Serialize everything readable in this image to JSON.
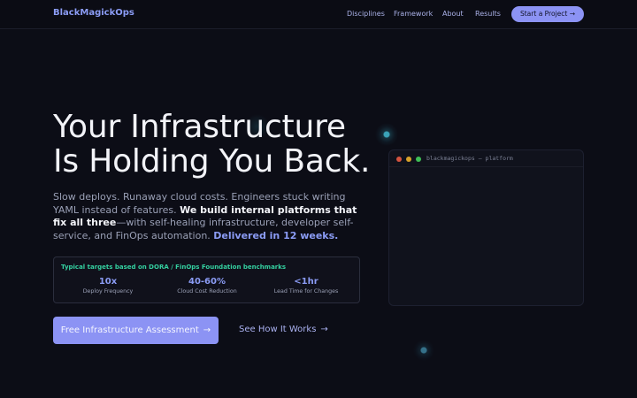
{
  "nav": {
    "brand": "BlackMagickOps",
    "links": [
      "Disciplines",
      "Framework",
      "About",
      "Results"
    ],
    "cta": "Start a Project →"
  },
  "hero": {
    "title_line1": "Your Infrastructure",
    "title_line2": "Is Holding You Back.",
    "sub_part1": "Slow deploys. Runaway cloud costs. Engineers stuck writing YAML instead of features. ",
    "sub_bold": "We build internal platforms that fix all three",
    "sub_part2": "—with self-healing infrastructure, developer self-service, and FinOps automation. ",
    "sub_accent": "Delivered in 12 weeks."
  },
  "metrics": {
    "caption": "Typical targets based on DORA / FinOps Foundation benchmarks",
    "items": [
      {
        "value": "10x",
        "label": "Deploy Frequency"
      },
      {
        "value": "40-60%",
        "label": "Cloud Cost Reduction"
      },
      {
        "value": "<1hr",
        "label": "Lead Time for Changes"
      }
    ]
  },
  "buttons": {
    "primary": "Free Infrastructure Assessment",
    "secondary": "See How It Works",
    "arrow": "→"
  },
  "terminal": {
    "title": "blackmagickops — platform"
  },
  "colors": {
    "background": "#0c0d16",
    "accent": "#8c93f4",
    "accent_text": "#8b9cf5",
    "caption_green": "#34d0a0"
  }
}
